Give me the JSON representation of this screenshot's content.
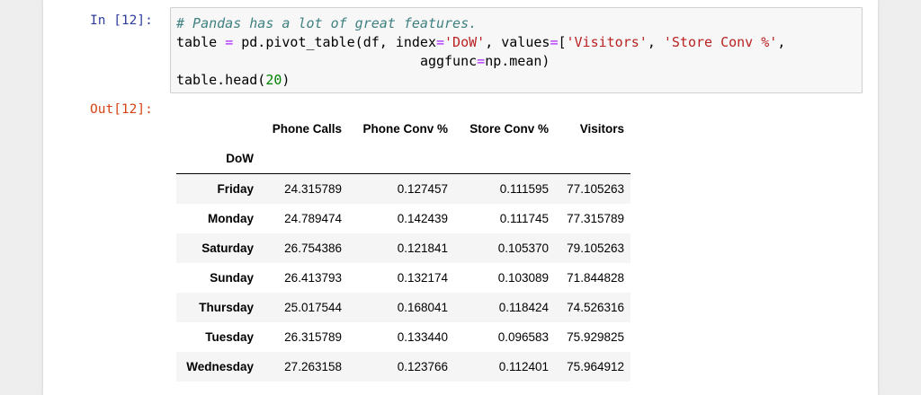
{
  "cell": {
    "in_prompt": "In [12]:",
    "out_prompt": "Out[12]:",
    "code": {
      "line1_comment": "# Pandas has a lot of great features.",
      "line2_a": "table ",
      "line2_eq": "=",
      "line2_b": " pd.pivot_table(df, index",
      "line2_eq2": "=",
      "line2_str1": "'DoW'",
      "line2_c": ", values",
      "line2_eq3": "=",
      "line2_d": "[",
      "line2_str2": "'Visitors'",
      "line2_e": ", ",
      "line2_str3": "'Store Conv %'",
      "line2_f": ",",
      "line3_indent": "                              ",
      "line3_a": "aggfunc",
      "line3_eq": "=",
      "line3_b": "np.mean)",
      "line4_a": "table.head(",
      "line4_num": "20",
      "line4_b": ")"
    }
  },
  "table": {
    "columns": [
      "Phone Calls",
      "Phone Conv %",
      "Store Conv %",
      "Visitors"
    ],
    "index_name": "DoW",
    "rows": [
      {
        "index": "Friday",
        "values": [
          "24.315789",
          "0.127457",
          "0.111595",
          "77.105263"
        ]
      },
      {
        "index": "Monday",
        "values": [
          "24.789474",
          "0.142439",
          "0.111745",
          "77.315789"
        ]
      },
      {
        "index": "Saturday",
        "values": [
          "26.754386",
          "0.121841",
          "0.105370",
          "79.105263"
        ]
      },
      {
        "index": "Sunday",
        "values": [
          "26.413793",
          "0.132174",
          "0.103089",
          "71.844828"
        ]
      },
      {
        "index": "Thursday",
        "values": [
          "25.017544",
          "0.168041",
          "0.118424",
          "74.526316"
        ]
      },
      {
        "index": "Tuesday",
        "values": [
          "26.315789",
          "0.133440",
          "0.096583",
          "75.929825"
        ]
      },
      {
        "index": "Wednesday",
        "values": [
          "27.263158",
          "0.123766",
          "0.112401",
          "75.964912"
        ]
      }
    ]
  }
}
